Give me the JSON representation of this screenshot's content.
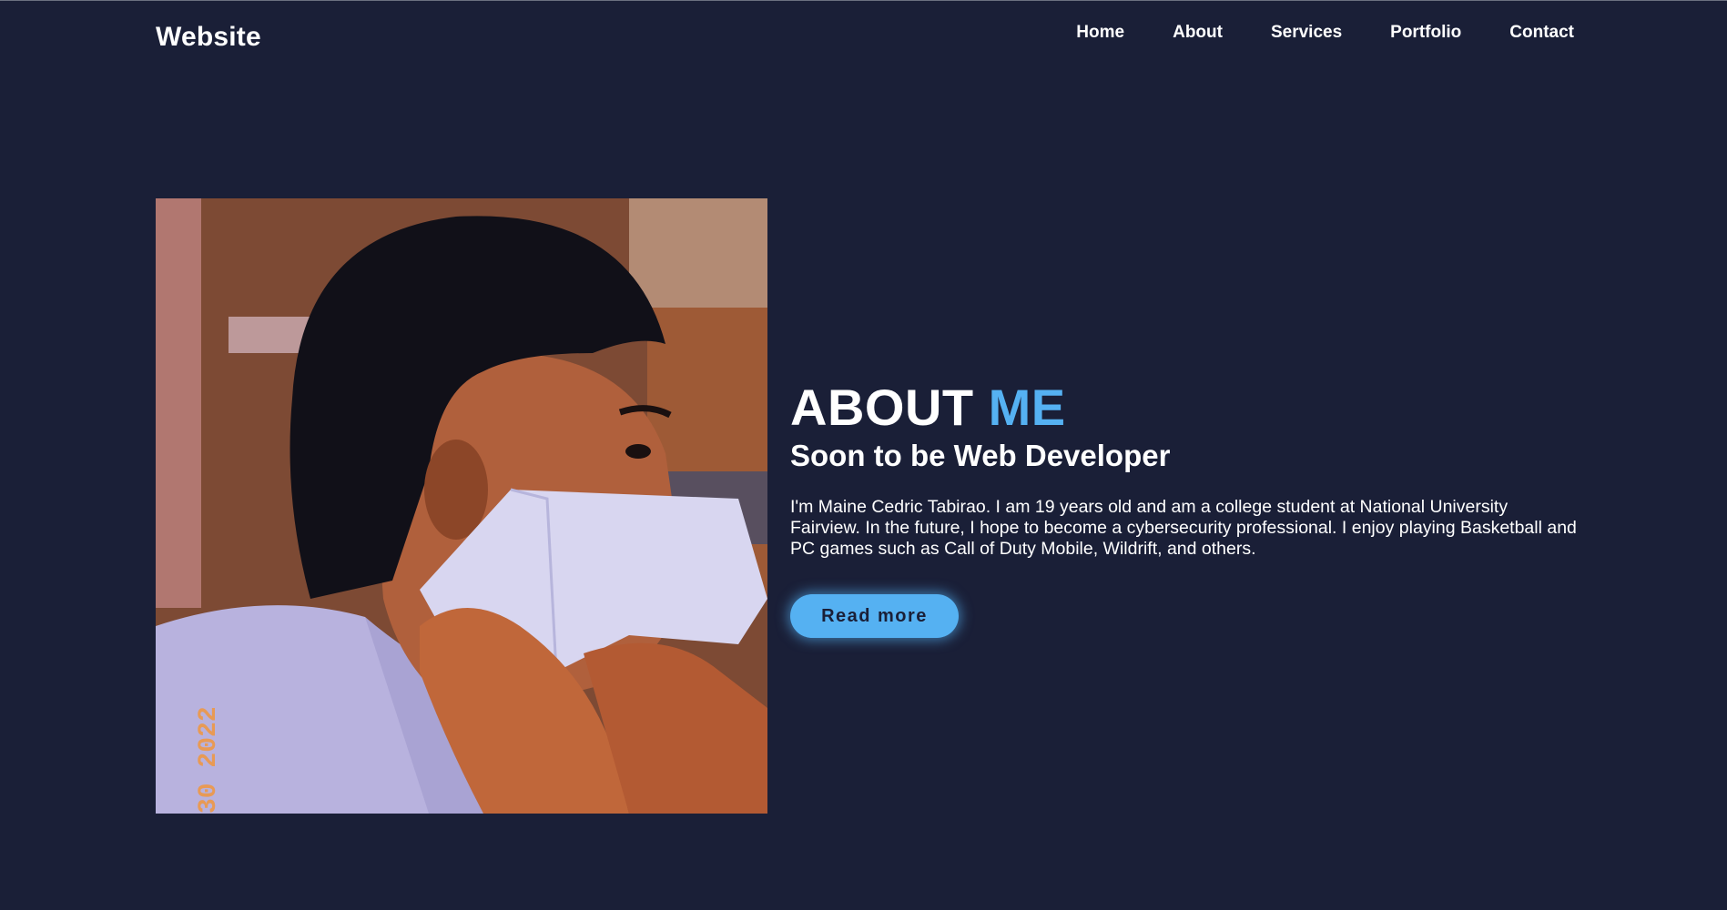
{
  "header": {
    "logo": "Website",
    "nav": [
      "Home",
      "About",
      "Services",
      "Portfolio",
      "Contact"
    ]
  },
  "about": {
    "title_main": "ABOUT ",
    "title_accent": "ME",
    "subtitle": "Soon to be Web Developer",
    "bio": "I'm Maine Cedric Tabirao. I am 19 years old and am a college student at National University Fairview. In the future, I hope to become a cybersecurity professional. I enjoy playing Basketball and PC games such as Call of Duty Mobile, Wildrift, and others.",
    "button": "Read more",
    "photo_date_stamp": "30 2022"
  },
  "colors": {
    "background": "#1a1f37",
    "accent": "#55b1f2",
    "text": "#ffffff"
  }
}
